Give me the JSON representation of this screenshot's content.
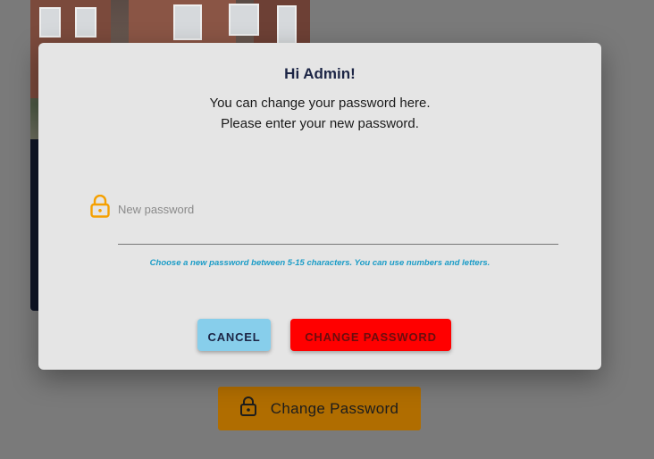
{
  "background": {
    "button_label": "Change Password",
    "button_icon": "lock-icon",
    "button_color": "#b06d00"
  },
  "dialog": {
    "title": "Hi Admin!",
    "line1": "You can change your password here.",
    "line2": "Please enter your new password.",
    "field_icon": "lock-icon",
    "password_placeholder": "New password",
    "password_value": "",
    "hint": "Choose a new password between 5-15 characters. You can use numbers and letters.",
    "cancel_label": "CANCEL",
    "change_label": "CHANGE PASSWORD",
    "colors": {
      "cancel": "#87ceeb",
      "change": "#ff0000",
      "icon": "#f5a000",
      "hint": "#1a9cc7"
    }
  }
}
